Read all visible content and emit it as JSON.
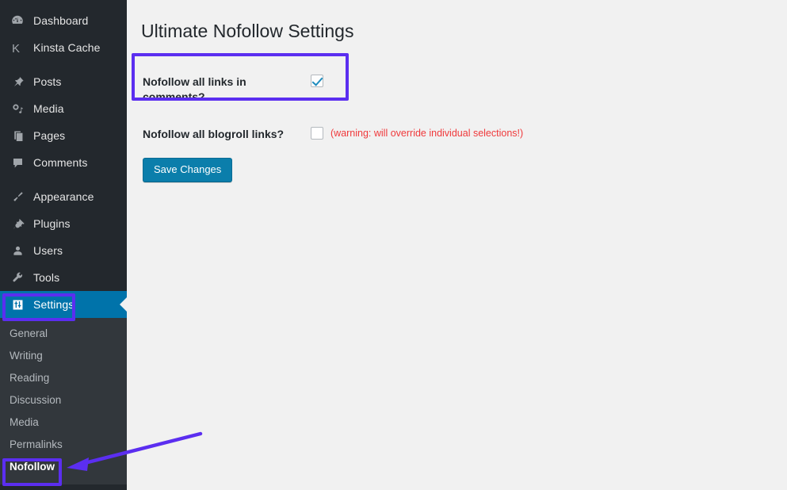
{
  "colors": {
    "sidebar_bg": "#23282d",
    "submenu_bg": "#32373c",
    "current_blue": "#0073aa",
    "content_bg": "#f1f1f1",
    "annotation_purple": "#5b2ef0",
    "warning_red": "#f0393b",
    "button_blue": "#0b7eab",
    "checkmark_blue": "#1e8cbe"
  },
  "sidebar": {
    "items": [
      {
        "label": "Dashboard",
        "icon": "dashboard-icon",
        "current": false
      },
      {
        "label": "Kinsta Cache",
        "icon": "kinsta-k-icon",
        "current": false
      },
      {
        "label": "Posts",
        "icon": "pin-icon",
        "current": false
      },
      {
        "label": "Media",
        "icon": "media-icon",
        "current": false
      },
      {
        "label": "Pages",
        "icon": "page-icon",
        "current": false
      },
      {
        "label": "Comments",
        "icon": "comment-icon",
        "current": false
      },
      {
        "label": "Appearance",
        "icon": "paintbrush-icon",
        "current": false
      },
      {
        "label": "Plugins",
        "icon": "plug-icon",
        "current": false
      },
      {
        "label": "Users",
        "icon": "user-icon",
        "current": false
      },
      {
        "label": "Tools",
        "icon": "wrench-icon",
        "current": false
      },
      {
        "label": "Settings",
        "icon": "sliders-icon",
        "current": true
      }
    ],
    "submenu": [
      {
        "label": "General",
        "current": false
      },
      {
        "label": "Writing",
        "current": false
      },
      {
        "label": "Reading",
        "current": false
      },
      {
        "label": "Discussion",
        "current": false
      },
      {
        "label": "Media",
        "current": false
      },
      {
        "label": "Permalinks",
        "current": false
      },
      {
        "label": "Nofollow",
        "current": true
      }
    ]
  },
  "main": {
    "title": "Ultimate Nofollow Settings",
    "rows": [
      {
        "label": "Nofollow all links in comments?",
        "checked": true,
        "note": ""
      },
      {
        "label": "Nofollow all blogroll links?",
        "checked": false,
        "note": "(warning: will override individual selections!)"
      }
    ],
    "save_label": "Save Changes"
  },
  "annotations": {
    "highlight_comments_row": "purple-rectangle",
    "highlight_settings_menu": "purple-rectangle",
    "highlight_nofollow_submenu": "purple-rectangle",
    "arrow_to_nofollow": "purple-arrow"
  }
}
